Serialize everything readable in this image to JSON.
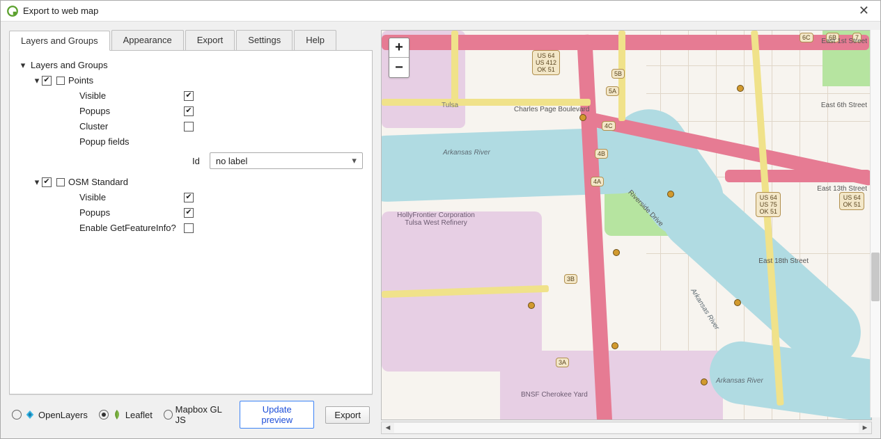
{
  "window": {
    "title": "Export to web map"
  },
  "tabs": {
    "layers": "Layers and Groups",
    "appearance": "Appearance",
    "export": "Export",
    "settings": "Settings",
    "help": "Help"
  },
  "tree": {
    "root_label": "Layers and Groups",
    "points": {
      "name": "Points",
      "visible_label": "Visible",
      "popups_label": "Popups",
      "cluster_label": "Cluster",
      "popup_fields_label": "Popup fields",
      "id_label": "Id",
      "id_value": "no label"
    },
    "osm": {
      "name": "OSM Standard",
      "visible_label": "Visible",
      "popups_label": "Popups",
      "gfi_label": "Enable GetFeatureInfo?"
    }
  },
  "engines": {
    "openlayers": "OpenLayers",
    "leaflet": "Leaflet",
    "mapbox": "Mapbox GL JS"
  },
  "buttons": {
    "update_preview": "Update preview",
    "export": "Export"
  },
  "map": {
    "zoom_in": "+",
    "zoom_out": "−",
    "river_label": "Arkansas River",
    "river_label2": "Arkansas River",
    "river_label3": "Arkansas River",
    "charles_page": "Charles Page Boulevard",
    "riverside": "Riverside Drive",
    "tulsa": "Tulsa",
    "hollyfrontier": "HollyFrontier Corporation Tulsa West Refinery",
    "bnsf": "BNSF Cherokee Yard",
    "e1st": "East 1st Street",
    "e6th": "East 6th Street",
    "e13th": "East 13th Street",
    "e18th": "East 18th Street",
    "shields": {
      "s1": "US 64\nUS 412\nOK 51",
      "s2": "US 64\nUS 75\nOK 51",
      "s3": "US 64\nOK 51"
    },
    "exits": {
      "a3": "3A",
      "b3": "3B",
      "a4": "4A",
      "b4": "4B",
      "c4": "4C",
      "a5": "5A",
      "b5": "5B",
      "c6": "6C",
      "b6": "6B",
      "n7": "7"
    }
  }
}
